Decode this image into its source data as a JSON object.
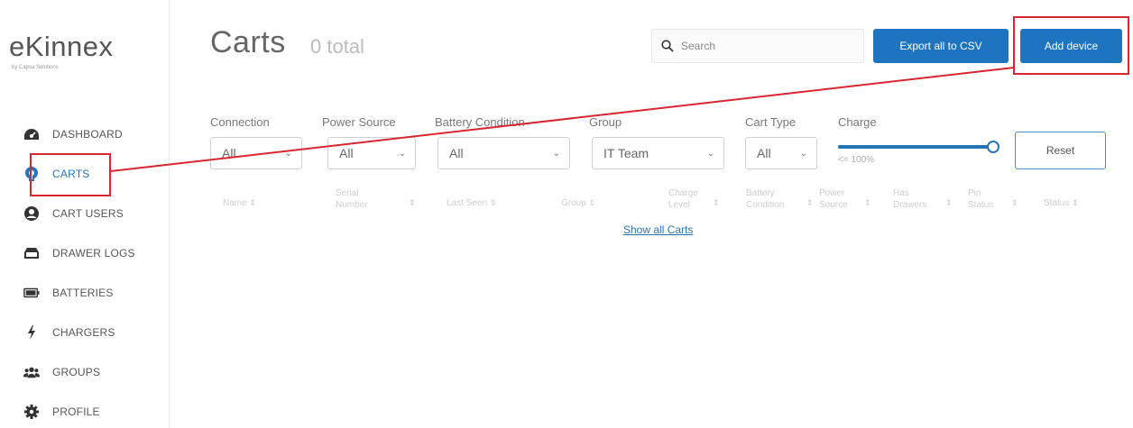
{
  "brand": {
    "name": "eKinnex",
    "subtitle": "by Capsa Solutions"
  },
  "nav": [
    {
      "label": "DASHBOARD",
      "icon": "dashboard-icon"
    },
    {
      "label": "CARTS",
      "icon": "carts-icon",
      "active": true
    },
    {
      "label": "CART USERS",
      "icon": "user-icon"
    },
    {
      "label": "DRAWER LOGS",
      "icon": "drawer-icon"
    },
    {
      "label": "BATTERIES",
      "icon": "battery-icon"
    },
    {
      "label": "CHARGERS",
      "icon": "lightning-icon"
    },
    {
      "label": "GROUPS",
      "icon": "groups-icon"
    },
    {
      "label": "PROFILE",
      "icon": "gear-icon"
    }
  ],
  "header": {
    "title": "Carts",
    "count": "0 total",
    "search_placeholder": "Search",
    "export_label": "Export all to CSV",
    "add_label": "Add device"
  },
  "filters": {
    "connection": {
      "label": "Connection",
      "value": "All"
    },
    "power_source": {
      "label": "Power Source",
      "value": "All"
    },
    "battery_condition": {
      "label": "Battery Condition",
      "value": "All"
    },
    "group": {
      "label": "Group",
      "value": "IT Team"
    },
    "cart_type": {
      "label": "Cart Type",
      "value": "All"
    },
    "charge": {
      "label": "Charge",
      "value_text": "<= 100%",
      "value": 100
    },
    "reset_label": "Reset"
  },
  "table": {
    "columns": [
      [
        "Name"
      ],
      [
        "Serial",
        "Number"
      ],
      [
        "Last Seen"
      ],
      [
        "Group"
      ],
      [
        "Charge",
        "Level"
      ],
      [
        "Battery",
        "Condition"
      ],
      [
        "Power",
        "Source"
      ],
      [
        "Has",
        "Drawers"
      ],
      [
        "Pin",
        "Status"
      ],
      [
        "Status"
      ]
    ],
    "show_all_label": "Show all Carts"
  },
  "colors": {
    "accent": "#1f74c0",
    "highlight": "#d8262e"
  }
}
